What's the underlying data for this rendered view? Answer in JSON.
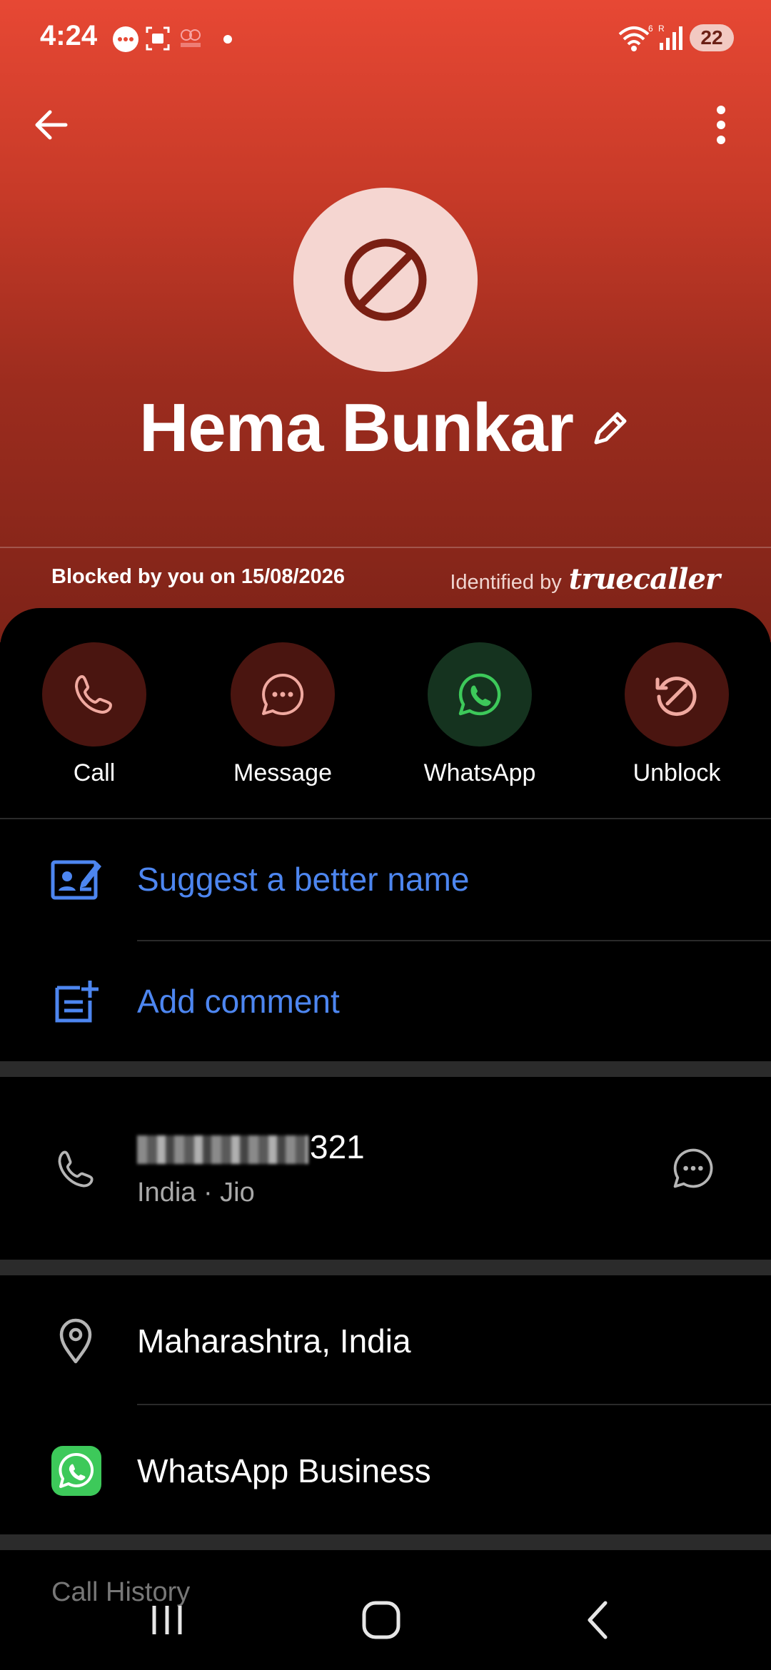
{
  "status_bar": {
    "time": "4:24",
    "battery": "22"
  },
  "contact": {
    "name": "Hema Bunkar",
    "blocked_text": "Blocked by you on 15/08/2026",
    "identified_by": "Identified by",
    "brand": "truecaller"
  },
  "actions": [
    {
      "label": "Call",
      "icon": "phone-icon"
    },
    {
      "label": "Message",
      "icon": "message-icon"
    },
    {
      "label": "WhatsApp",
      "icon": "whatsapp-icon"
    },
    {
      "label": "Unblock",
      "icon": "unblock-icon"
    }
  ],
  "options": {
    "suggest_name": "Suggest a better name",
    "add_comment": "Add comment"
  },
  "phone": {
    "number_visible_suffix": "321",
    "carrier_line": "India · Jio"
  },
  "location": "Maharashtra, India",
  "whatsapp_business": "WhatsApp Business",
  "call_history_label": "Call History",
  "colors": {
    "accent_blue": "#4d86f0",
    "header_top": "#e74834",
    "header_bottom": "#7e2318",
    "whatsapp_green": "#3dc95a"
  }
}
